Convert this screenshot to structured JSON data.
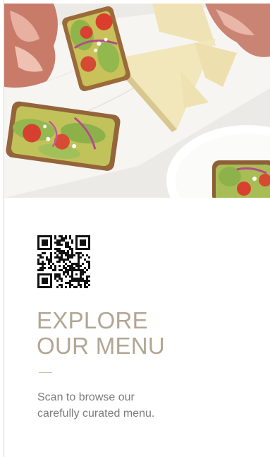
{
  "hero": {
    "image": "food-photo-avocado-toast-cheese-prosciutto"
  },
  "qr": {
    "icon": "qr-code-icon"
  },
  "headline": {
    "line1": "EXPLORE",
    "line2": "OUR MENU",
    "color": "#b3a594"
  },
  "description": {
    "line1": "Scan to browse our",
    "line2": "carefully curated menu.",
    "color": "#7c7c7c"
  },
  "colors": {
    "background": "#ffffff",
    "divider": "#c9bcad"
  }
}
